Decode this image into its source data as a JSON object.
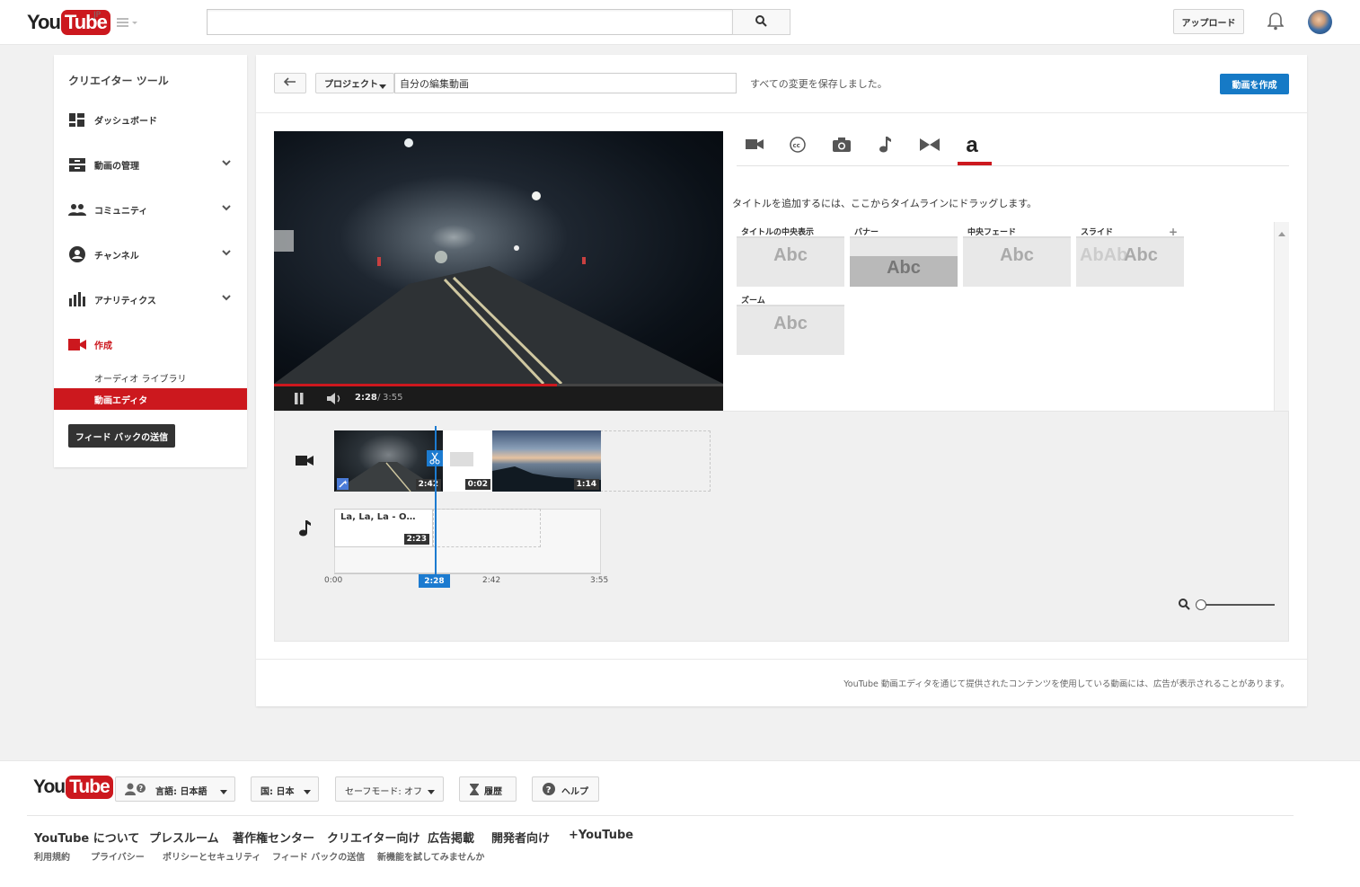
{
  "masthead": {
    "logo_you": "You",
    "logo_tube": "Tube",
    "region": "JP",
    "search_placeholder": "",
    "upload_label": "アップロード"
  },
  "sidebar": {
    "title": "クリエイター ツール",
    "items": [
      {
        "label": "ダッシュボード",
        "icon": "dashboard-icon"
      },
      {
        "label": "動画の管理",
        "icon": "video-manager-icon"
      },
      {
        "label": "コミュニティ",
        "icon": "community-icon"
      },
      {
        "label": "チャンネル",
        "icon": "channel-icon"
      },
      {
        "label": "アナリティクス",
        "icon": "analytics-icon"
      },
      {
        "label": "作成",
        "icon": "create-icon"
      }
    ],
    "subitems": [
      {
        "label": "オーディオ ライブラリ"
      },
      {
        "label": "動画エディタ"
      }
    ],
    "feedback_label": "フィード バックの送信",
    "accent": "#cc181e"
  },
  "editor": {
    "project_label": "プロジェクト",
    "project_name": "自分の編集動画",
    "save_status": "すべての変更を保存しました。",
    "create_label": "動画を作成",
    "player": {
      "current": "2:28",
      "separator": " / ",
      "total": "3:55",
      "progress": 0.63
    },
    "tabs": [
      "video-tab-icon",
      "cc-tab-icon",
      "photo-tab-icon",
      "music-tab-icon",
      "transition-tab-icon",
      "text-tab-icon"
    ],
    "text_tab_glyph": "a",
    "hint": "タイトルを追加するには、ここからタイムラインにドラッグします。",
    "templates": [
      {
        "name": "タイトルの中央表示",
        "sample": "Abc"
      },
      {
        "name": "バナー",
        "sample": "Abc"
      },
      {
        "name": "中央フェード",
        "sample": "Abc"
      },
      {
        "name": "スライド",
        "sample": "Abc",
        "ghost": "AbAb"
      },
      {
        "name": "ズーム",
        "sample": "Abc"
      }
    ],
    "timeline": {
      "clips": [
        {
          "duration": "2:42"
        },
        {
          "duration": "0:02"
        },
        {
          "duration": "1:14"
        }
      ],
      "audio": {
        "title": "La, La, La - O…",
        "duration": "2:23"
      },
      "ticks": [
        "0:00",
        "2:42",
        "3:55"
      ],
      "playhead": "2:28"
    },
    "disclaimer": "YouTube 動画エディタを通じて提供されたコンテンツを使用している動画には、広告が表示されることがあります。"
  },
  "footer": {
    "language": "言語: 日本語",
    "country": "国: 日本",
    "safety": "セーフモード: オフ",
    "history": "履歴",
    "help": "ヘルプ",
    "links": [
      "YouTube について",
      "プレスルーム",
      "著作権センター",
      "クリエイター向け",
      "広告掲載",
      "開発者向け",
      "+YouTube"
    ],
    "links2": [
      "利用規約",
      "プライバシー",
      "ポリシーとセキュリティ",
      "フィード バックの送信",
      "新機能を試してみませんか"
    ]
  }
}
